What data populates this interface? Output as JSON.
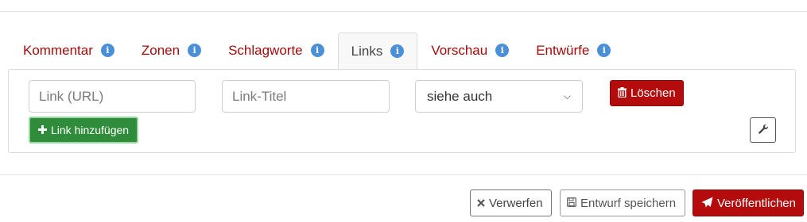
{
  "tabs": [
    {
      "label": "Kommentar",
      "info_icon": "info-icon"
    },
    {
      "label": "Zonen",
      "info_icon": "info-icon"
    },
    {
      "label": "Schlagworte",
      "info_icon": "info-icon"
    },
    {
      "label": "Links",
      "info_icon": "info-icon",
      "active": true
    },
    {
      "label": "Vorschau",
      "info_icon": "info-icon"
    },
    {
      "label": "Entwürfe",
      "info_icon": "info-icon"
    }
  ],
  "info_glyph": "i",
  "links_panel": {
    "url_placeholder": "Link (URL)",
    "title_placeholder": "Link-Titel",
    "relation_selected": "siehe auch",
    "delete_label": "Löschen",
    "add_label": "Link hinzufügen"
  },
  "footer": {
    "discard_label": "Verwerfen",
    "save_draft_label": "Entwurf speichern",
    "publish_label": "Veröffentlichen"
  },
  "colors": {
    "accent_red": "#b40c0c",
    "tab_text": "#a30b0b",
    "success_green": "#2f8c3a",
    "info_blue": "#4a90d9"
  }
}
